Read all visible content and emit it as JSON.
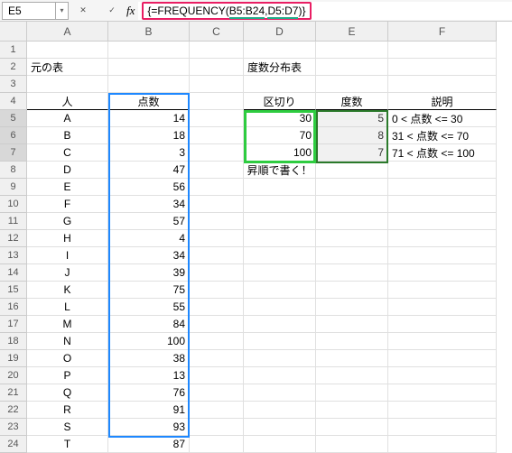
{
  "formula_bar": {
    "cell_ref": "E5",
    "fx_label": "fx",
    "formula_prefix": "{=FREQUENCY(",
    "formula_arg1": "B5:B24",
    "formula_sep": ",",
    "formula_arg2": "D5:D7",
    "formula_suffix": ")}"
  },
  "col_headers": [
    "A",
    "B",
    "C",
    "D",
    "E",
    "F"
  ],
  "labels": {
    "source_table": "元の表",
    "freq_table": "度数分布表",
    "person": "人",
    "score": "点数",
    "bins": "区切り",
    "freq": "度数",
    "desc": "説明",
    "note": "昇順で書く！"
  },
  "people": [
    {
      "name": "A",
      "score": 14
    },
    {
      "name": "B",
      "score": 18
    },
    {
      "name": "C",
      "score": 3
    },
    {
      "name": "D",
      "score": 47
    },
    {
      "name": "E",
      "score": 56
    },
    {
      "name": "F",
      "score": 34
    },
    {
      "name": "G",
      "score": 57
    },
    {
      "name": "H",
      "score": 4
    },
    {
      "name": "I",
      "score": 34
    },
    {
      "name": "J",
      "score": 39
    },
    {
      "name": "K",
      "score": 75
    },
    {
      "name": "L",
      "score": 55
    },
    {
      "name": "M",
      "score": 84
    },
    {
      "name": "N",
      "score": 100
    },
    {
      "name": "O",
      "score": 38
    },
    {
      "name": "P",
      "score": 13
    },
    {
      "name": "Q",
      "score": 76
    },
    {
      "name": "R",
      "score": 91
    },
    {
      "name": "S",
      "score": 93
    },
    {
      "name": "T",
      "score": 87
    }
  ],
  "freq_rows": [
    {
      "bin": 30,
      "count": 5,
      "desc": "0 < 点数 <= 30"
    },
    {
      "bin": 70,
      "count": 8,
      "desc": "31 < 点数 <= 70"
    },
    {
      "bin": 100,
      "count": 7,
      "desc": "71 < 点数 <= 100"
    }
  ],
  "chart_data": {
    "type": "table",
    "title": "度数分布表",
    "columns": [
      "区切り",
      "度数",
      "説明"
    ],
    "rows": [
      [
        30,
        5,
        "0 < 点数 <= 30"
      ],
      [
        70,
        8,
        "31 < 点数 <= 70"
      ],
      [
        100,
        7,
        "71 < 点数 <= 100"
      ]
    ],
    "source": {
      "label": "点数",
      "values": [
        14,
        18,
        3,
        47,
        56,
        34,
        57,
        4,
        34,
        39,
        75,
        55,
        84,
        100,
        38,
        13,
        76,
        91,
        93,
        87
      ]
    }
  }
}
